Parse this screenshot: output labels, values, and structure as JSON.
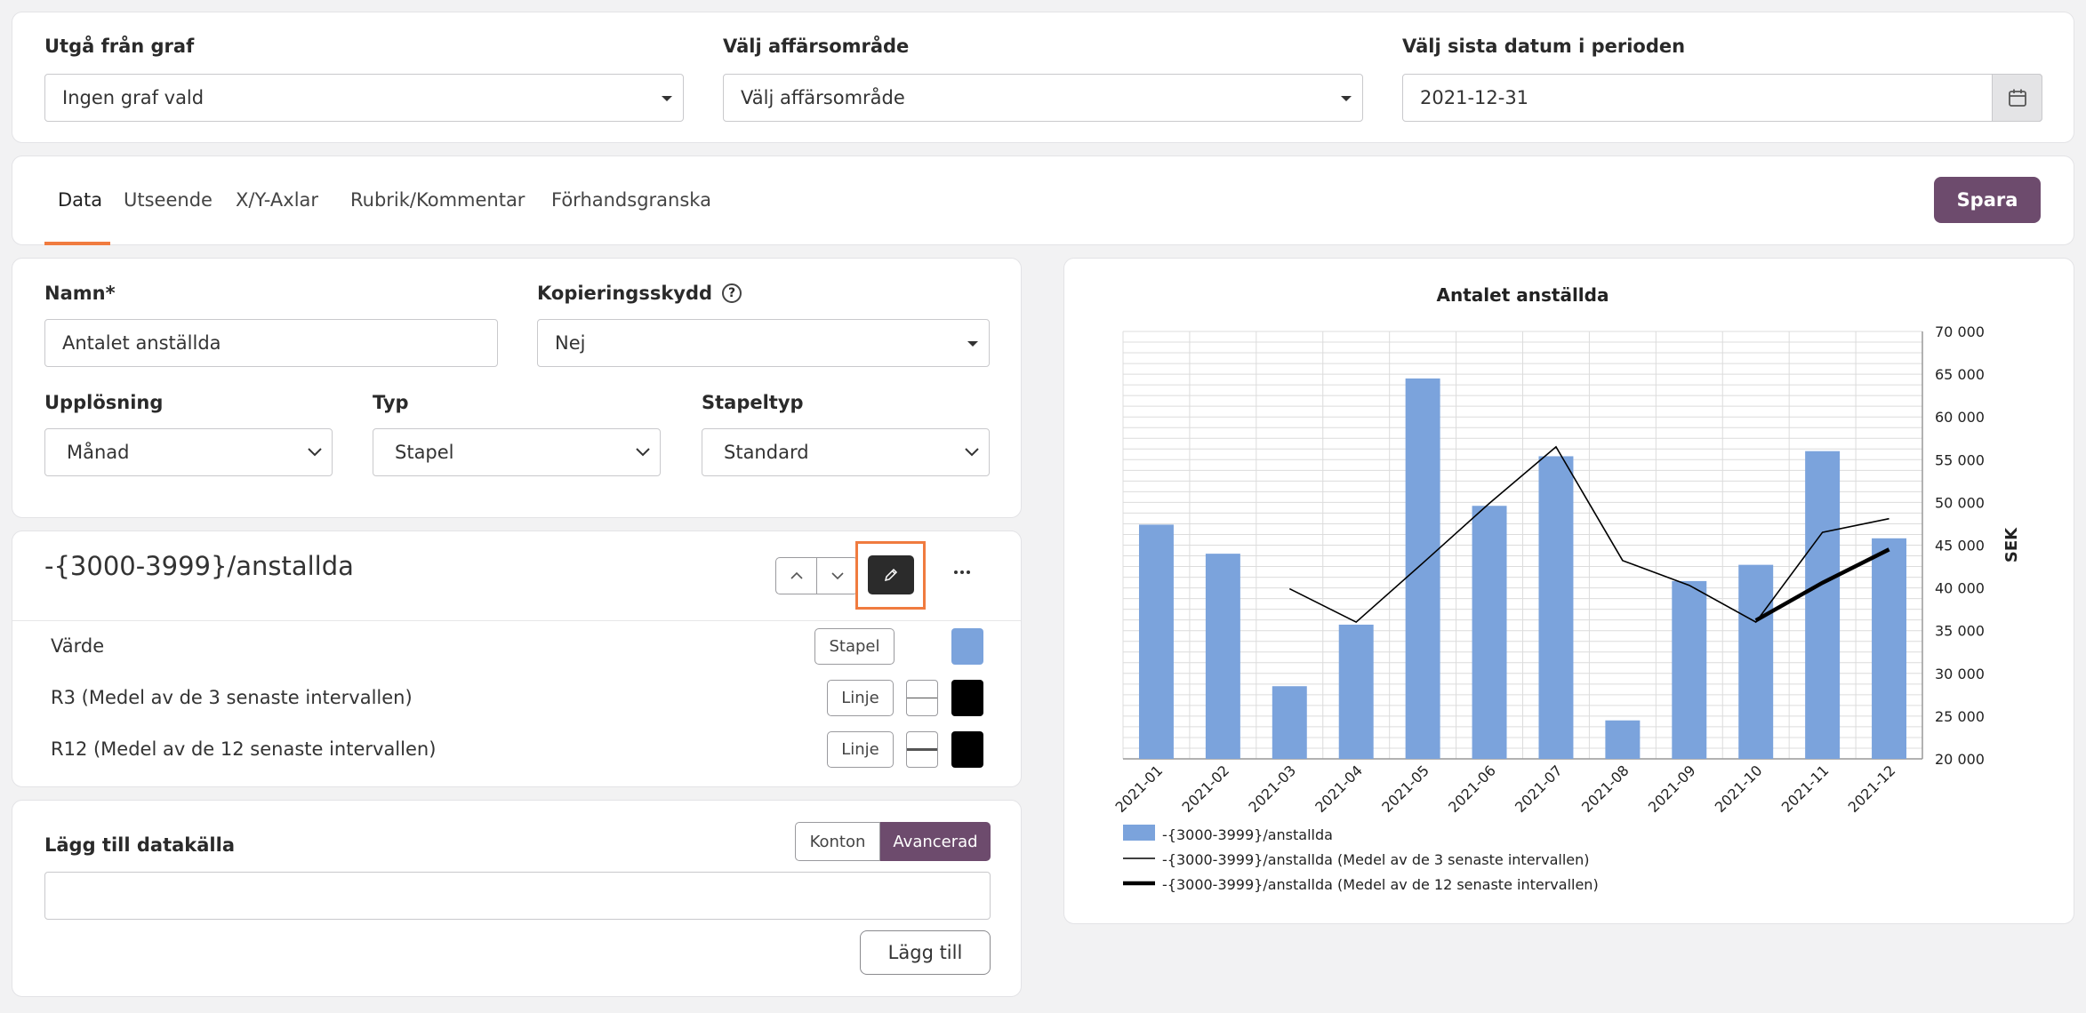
{
  "filters": {
    "graph": {
      "label": "Utgå från graf",
      "value": "Ingen graf vald"
    },
    "business_area": {
      "label": "Välj affärsområde",
      "value": "Välj affärsområde"
    },
    "last_date": {
      "label": "Välj sista datum i perioden",
      "value": "2021-12-31"
    }
  },
  "tabs": [
    {
      "label": "Data"
    },
    {
      "label": "Utseende"
    },
    {
      "label": "X/Y-Axlar"
    },
    {
      "label": "Rubrik/Kommentar"
    },
    {
      "label": "Förhandsgranska"
    }
  ],
  "active_tab": "Data",
  "save_label": "Spara",
  "form": {
    "name": {
      "label": "Namn*",
      "value": "Antalet anställda"
    },
    "copy_protection": {
      "label": "Kopieringsskydd",
      "value": "Nej"
    },
    "resolution": {
      "label": "Upplösning",
      "value": "Månad"
    },
    "type": {
      "label": "Typ",
      "value": "Stapel"
    },
    "bar_type": {
      "label": "Stapeltyp",
      "value": "Standard"
    }
  },
  "series_panel": {
    "title": "-{3000-3999}/anstallda",
    "rows": [
      {
        "label": "Värde",
        "button": "Stapel",
        "color": "#7ba3dc"
      },
      {
        "label": "R3 (Medel av de 3 senaste intervallen)",
        "button": "Linje",
        "color": "#000000"
      },
      {
        "label": "R12 (Medel av de 12 senaste intervallen)",
        "button": "Linje",
        "color": "#000000"
      }
    ]
  },
  "add_source": {
    "label": "Lägg till datakälla",
    "toggle": [
      "Konton",
      "Avancerad"
    ],
    "active_toggle": "Avancerad",
    "input_value": "",
    "button": "Lägg till"
  },
  "colors": {
    "accent": "#6d4b6d",
    "tab_underline": "#f07b3f",
    "highlight": "#f07b3f",
    "bar": "#7ba3dc"
  },
  "chart_data": {
    "type": "bar",
    "title": "Antalet anställda",
    "ylabel": "SEK",
    "xlabel": "",
    "ylim": [
      20000,
      70000
    ],
    "y_ticks": [
      "20 000",
      "25 000",
      "30 000",
      "35 000",
      "40 000",
      "45 000",
      "50 000",
      "55 000",
      "60 000",
      "65 000",
      "70 000"
    ],
    "categories": [
      "2021-01",
      "2021-02",
      "2021-03",
      "2021-04",
      "2021-05",
      "2021-06",
      "2021-07",
      "2021-08",
      "2021-09",
      "2021-10",
      "2021-11",
      "2021-12"
    ],
    "grid": true,
    "legend_position": "bottom-left",
    "series": [
      {
        "name": "-{3000-3999}/anstallda",
        "kind": "bar",
        "color": "#7ba3dc",
        "values": [
          47400,
          44000,
          28500,
          35700,
          64500,
          49600,
          55400,
          24500,
          40800,
          42700,
          56000,
          45800
        ]
      },
      {
        "name": "-{3000-3999}/anstallda (Medel av de 3 senaste intervallen)",
        "kind": "line",
        "color": "#000000",
        "stroke": "thin",
        "values": [
          null,
          null,
          39900,
          36000,
          42900,
          49900,
          56500,
          43200,
          40300,
          36000,
          46500,
          48100
        ]
      },
      {
        "name": "-{3000-3999}/anstallda (Medel av de 12 senaste intervallen)",
        "kind": "line",
        "color": "#000000",
        "stroke": "thick",
        "values": [
          null,
          null,
          null,
          null,
          null,
          null,
          null,
          null,
          null,
          36200,
          40600,
          44500
        ]
      }
    ]
  }
}
